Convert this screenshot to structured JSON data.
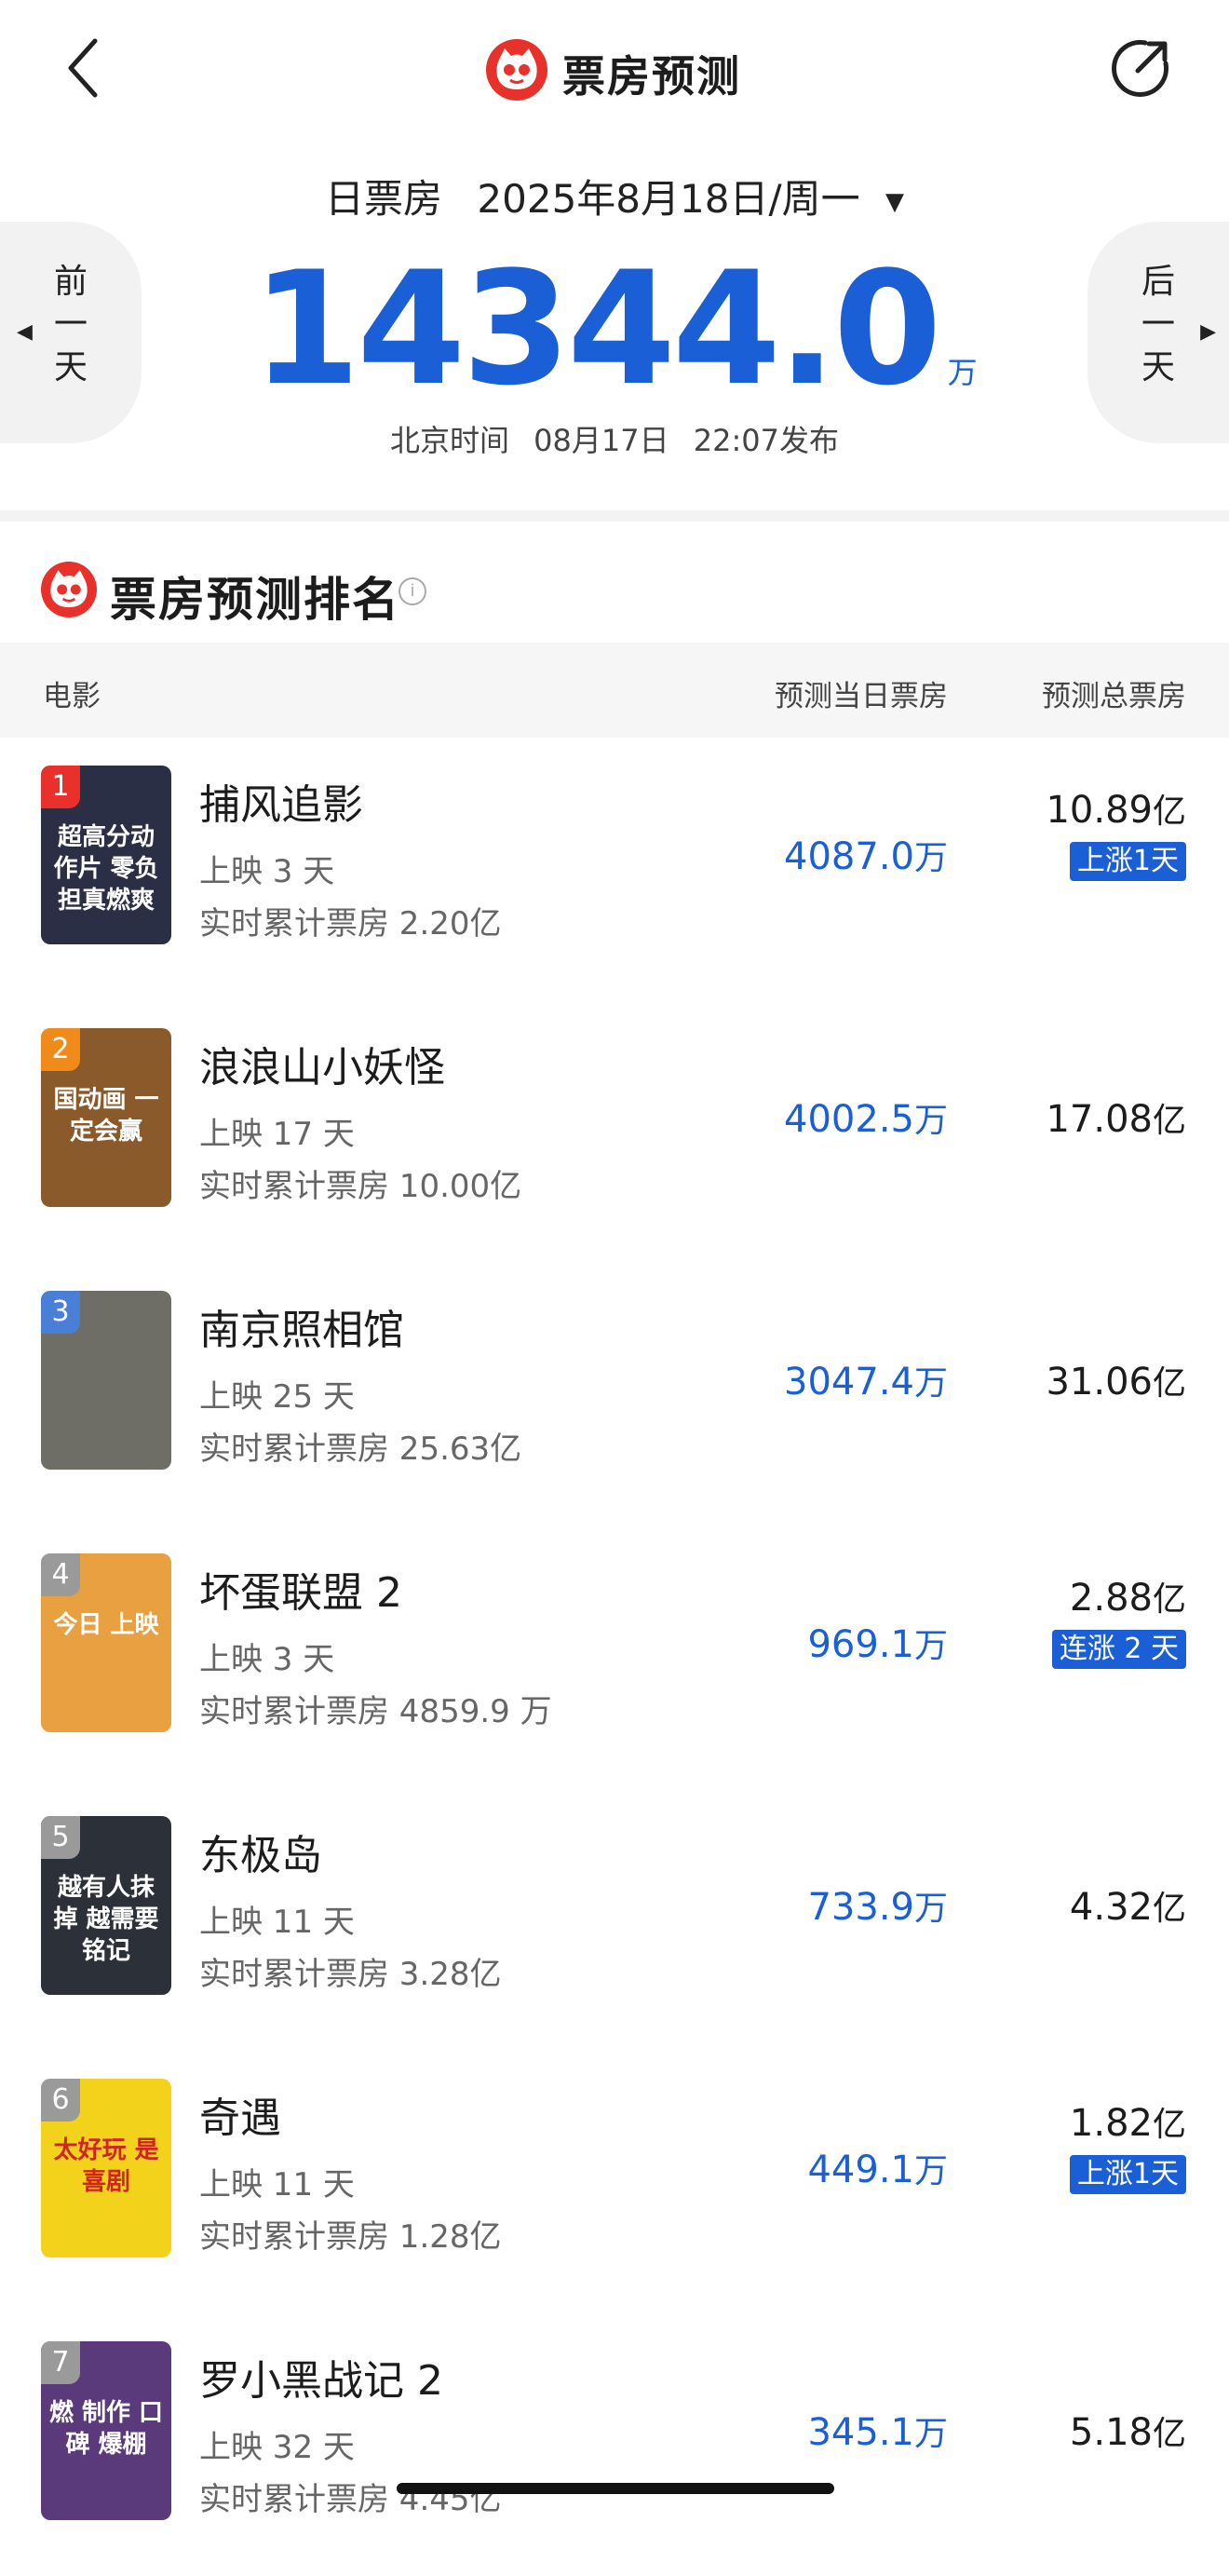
{
  "header": {
    "title": "票房预测",
    "back_icon": "chevron-left-icon",
    "share_icon": "share-icon"
  },
  "date_bar": {
    "type": "日票房",
    "date": "2025年8月18日/周一",
    "caret": "▼"
  },
  "nav": {
    "prev_label": [
      "前",
      "一",
      "天"
    ],
    "next_label": [
      "后",
      "一",
      "天"
    ],
    "prev_arrow": "◀",
    "next_arrow": "▶"
  },
  "total": {
    "value": "14344.0",
    "unit": "万"
  },
  "published": {
    "prefix": "北京时间",
    "date": "08月17日",
    "time": "22:07发布"
  },
  "ranking": {
    "title": "票房预测排名",
    "columns": {
      "movie": "电影",
      "day": "预测当日票房",
      "total": "预测总票房"
    },
    "items": [
      {
        "rank": "1",
        "title": "捕风追影",
        "days": "上映 3 天",
        "cumulative": "实时累计票房 2.20亿",
        "day_value": "4087.0",
        "day_unit": "万",
        "total_value": "10.89",
        "total_unit": "亿",
        "badge": "上涨1天",
        "badge_color": "#e8312b",
        "poster_text": "超高分动作片 零负担真燃爽",
        "poster_bg": "#2a2f45"
      },
      {
        "rank": "2",
        "title": "浪浪山小妖怪",
        "days": "上映 17 天",
        "cumulative": "实时累计票房 10.00亿",
        "day_value": "4002.5",
        "day_unit": "万",
        "total_value": "17.08",
        "total_unit": "亿",
        "badge": "",
        "badge_color": "#f08a1a",
        "poster_text": "国动画 一定会赢",
        "poster_bg": "#8a5a2b"
      },
      {
        "rank": "3",
        "title": "南京照相馆",
        "days": "上映 25 天",
        "cumulative": "实时累计票房 25.63亿",
        "day_value": "3047.4",
        "day_unit": "万",
        "total_value": "31.06",
        "total_unit": "亿",
        "badge": "",
        "badge_color": "#4a7fd8",
        "poster_text": "",
        "poster_bg": "#6e6e66"
      },
      {
        "rank": "4",
        "title": "坏蛋联盟 2",
        "days": "上映 3 天",
        "cumulative": "实时累计票房 4859.9 万",
        "day_value": "969.1",
        "day_unit": "万",
        "total_value": "2.88",
        "total_unit": "亿",
        "badge": "连涨 2 天",
        "badge_color": "#9a9a9a",
        "poster_text": "今日 上映",
        "poster_bg": "#e8a040"
      },
      {
        "rank": "5",
        "title": "东极岛",
        "days": "上映 11 天",
        "cumulative": "实时累计票房 3.28亿",
        "day_value": "733.9",
        "day_unit": "万",
        "total_value": "4.32",
        "total_unit": "亿",
        "badge": "",
        "badge_color": "#9a9a9a",
        "poster_text": "越有人抹掉 越需要铭记",
        "poster_bg": "#2c3038"
      },
      {
        "rank": "6",
        "title": "奇遇",
        "days": "上映 11 天",
        "cumulative": "实时累计票房 1.28亿",
        "day_value": "449.1",
        "day_unit": "万",
        "total_value": "1.82",
        "total_unit": "亿",
        "badge": "上涨1天",
        "badge_color": "#9a9a9a",
        "poster_text": "太好玩 是喜剧",
        "poster_bg": "#f2d21a"
      },
      {
        "rank": "7",
        "title": "罗小黑战记 2",
        "days": "上映 32 天",
        "cumulative": "实时累计票房 4.45亿",
        "day_value": "345.1",
        "day_unit": "万",
        "total_value": "5.18",
        "total_unit": "亿",
        "badge": "",
        "badge_color": "#9a9a9a",
        "poster_text": "燃 制作 口碑 爆棚",
        "poster_bg": "#5a3a7a"
      }
    ]
  },
  "colors": {
    "accent": "#1a5fd6",
    "brand": "#e8312b"
  }
}
